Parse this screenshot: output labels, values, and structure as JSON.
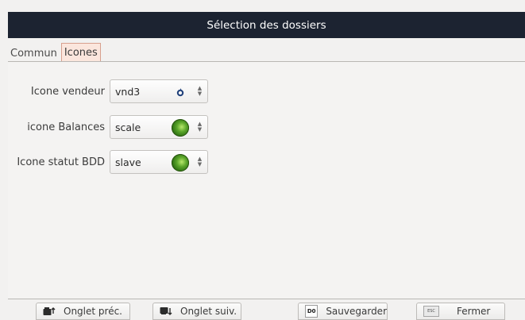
{
  "window": {
    "title": "Sélection des dossiers"
  },
  "tabs": [
    {
      "label": "Commun",
      "active": false
    },
    {
      "label": "Icones",
      "active": true
    }
  ],
  "fields": [
    {
      "label": "Icone vendeur",
      "value": "vnd3",
      "preview_icon": "small-vendor-icon"
    },
    {
      "label": "icone Balances",
      "value": "scale",
      "preview_icon": "green-ball-icon"
    },
    {
      "label": "Icone statut BDD",
      "value": "slave",
      "preview_icon": "green-ball-icon"
    }
  ],
  "buttons": {
    "prev_tab": {
      "label": "Onglet préc.",
      "icon": "tab-prev-icon"
    },
    "next_tab": {
      "label": "Onglet suiv.",
      "icon": "tab-next-icon"
    },
    "save": {
      "label": "Sauvegarder",
      "icon": "save-d0-icon",
      "icon_text": "D0"
    },
    "close": {
      "label": "Fermer",
      "icon": "escape-key-icon",
      "icon_text": "ESC"
    }
  },
  "colors": {
    "titlebar_bg": "#1c2331",
    "active_tab_bg": "#fbe6dd",
    "active_tab_border": "#d7a08e",
    "status_green": "#5aa52a"
  }
}
